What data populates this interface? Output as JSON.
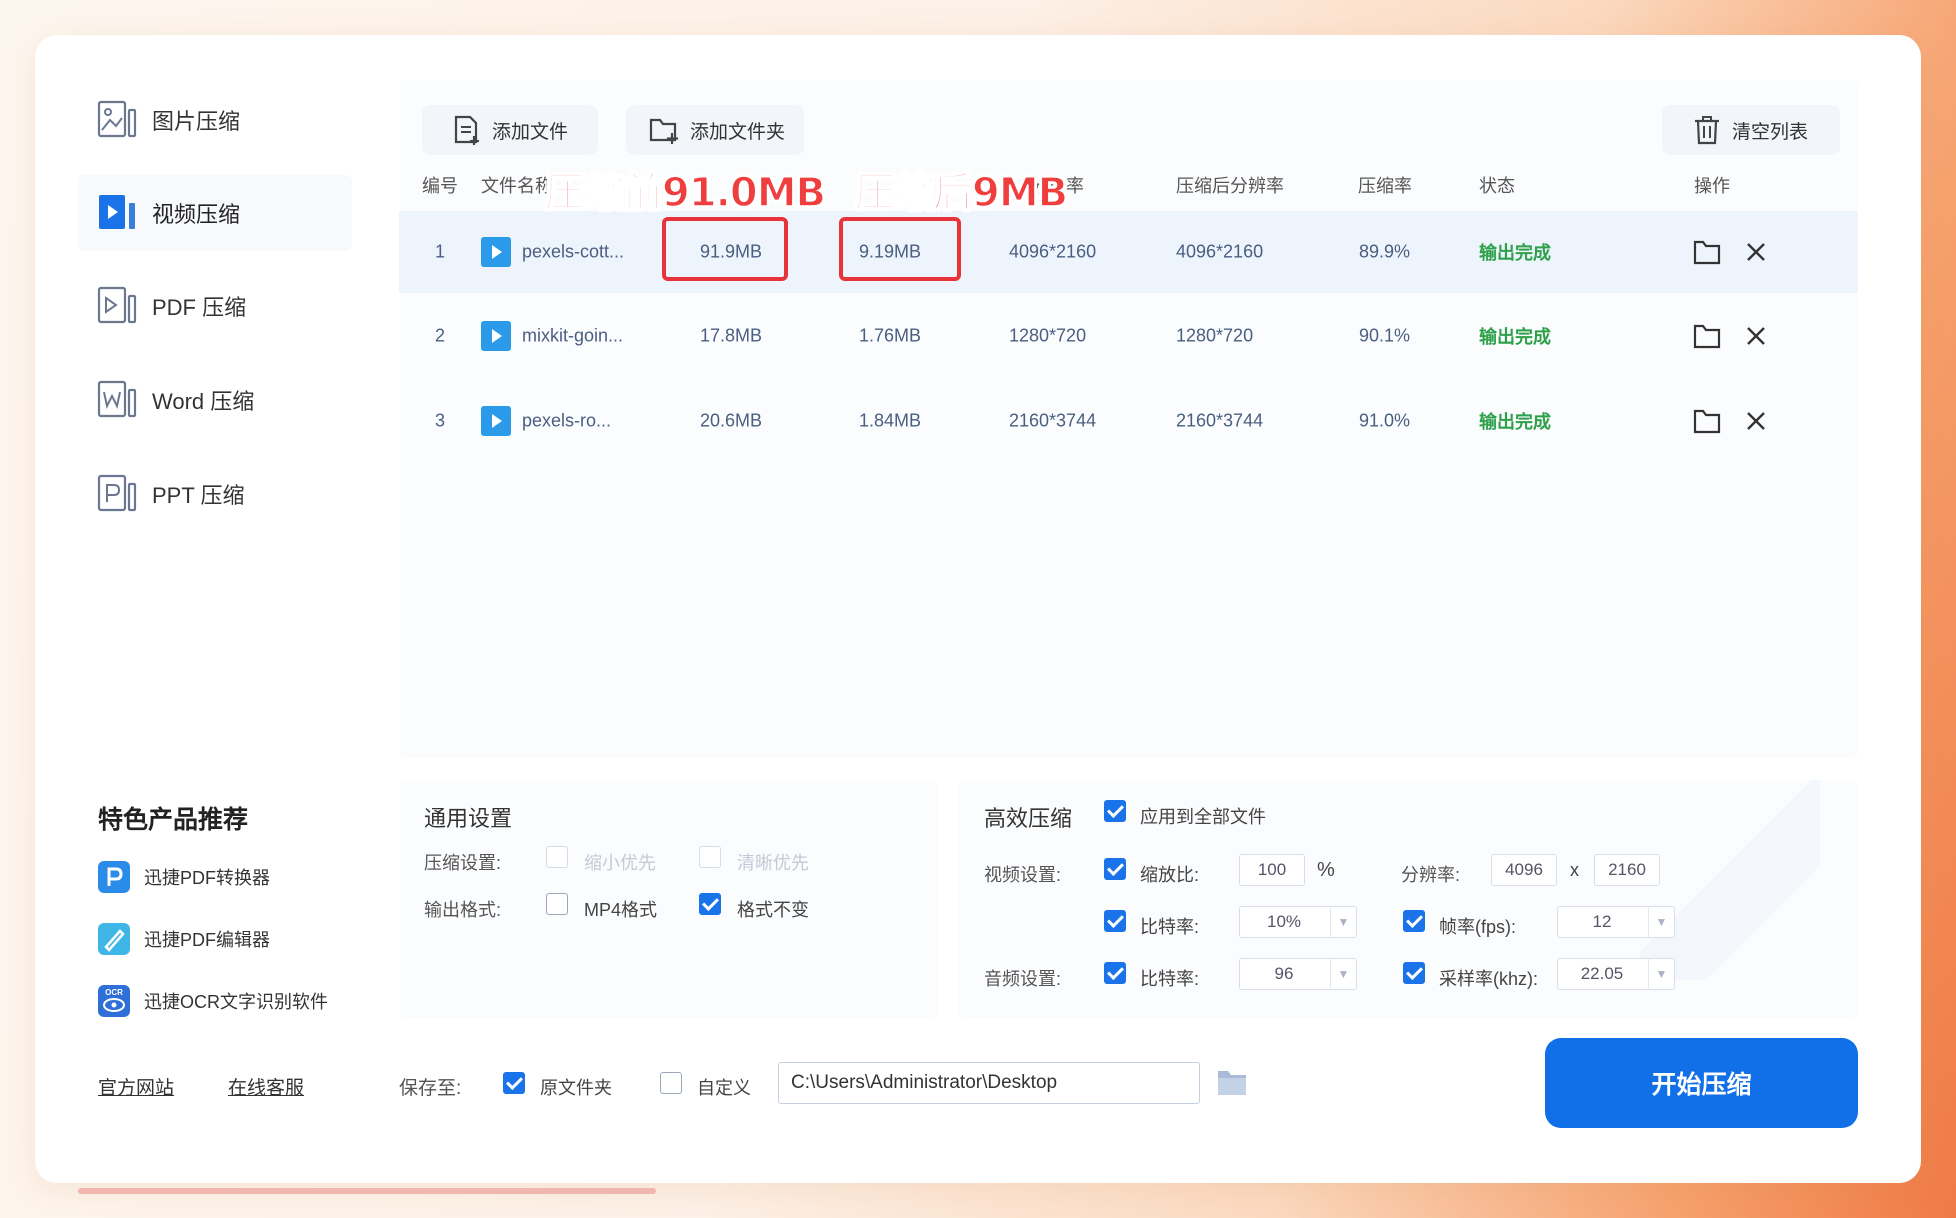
{
  "sidebar": {
    "items": [
      {
        "label": "图片压缩",
        "icon": "image-file-icon"
      },
      {
        "label": "视频压缩",
        "icon": "video-file-icon"
      },
      {
        "label": "PDF 压缩",
        "icon": "pdf-file-icon"
      },
      {
        "label": "Word 压缩",
        "icon": "word-file-icon"
      },
      {
        "label": "PPT 压缩",
        "icon": "ppt-file-icon"
      }
    ],
    "active_index": 1
  },
  "toolbar": {
    "add_file": "添加文件",
    "add_folder": "添加文件夹",
    "clear_list": "清空列表"
  },
  "table": {
    "headers": [
      "编号",
      "文件名称",
      "分辨率",
      "压缩后分辨率",
      "压缩率",
      "状态",
      "操作"
    ],
    "rows": [
      {
        "index": "1",
        "name": "pexels-cott...",
        "size_before": "91.9MB",
        "size_after": "9.19MB",
        "resolution": "4096*2160",
        "res_after": "4096*2160",
        "ratio": "89.9%",
        "status": "输出完成"
      },
      {
        "index": "2",
        "name": "mixkit-goin...",
        "size_before": "17.8MB",
        "size_after": "1.76MB",
        "resolution": "1280*720",
        "res_after": "1280*720",
        "ratio": "90.1%",
        "status": "输出完成"
      },
      {
        "index": "3",
        "name": "pexels-ro...",
        "size_before": "20.6MB",
        "size_after": "1.84MB",
        "resolution": "2160*3744",
        "res_after": "2160*3744",
        "ratio": "91.0%",
        "status": "输出完成"
      }
    ]
  },
  "annotations": {
    "before": "压缩前91.0MB",
    "after": "压缩后9MB"
  },
  "general_settings": {
    "title": "通用设置",
    "compress_label": "压缩设置:",
    "opt_small": "缩小优先",
    "opt_clear": "清晰优先",
    "format_label": "输出格式:",
    "opt_mp4": "MP4格式",
    "opt_keep": "格式不变"
  },
  "efficient": {
    "title": "高效压缩",
    "apply_all": "应用到全部文件",
    "video_label": "视频设置:",
    "scale_label": "缩放比:",
    "scale_value": "100",
    "scale_unit": "%",
    "resolution_label": "分辨率:",
    "res_w": "4096",
    "res_x": "x",
    "res_h": "2160",
    "bitrate_label": "比特率:",
    "bitrate_value": "10%",
    "fps_label": "帧率(fps):",
    "fps_value": "12",
    "audio_label": "音频设置:",
    "audio_bitrate_label": "比特率:",
    "audio_bitrate_value": "96",
    "sample_label": "采样率(khz):",
    "sample_value": "22.05"
  },
  "recommend": {
    "title": "特色产品推荐",
    "items": [
      "迅捷PDF转换器",
      "迅捷PDF编辑器",
      "迅捷OCR文字识别软件"
    ],
    "ocr_badge": "OCR"
  },
  "footer": {
    "website": "官方网站",
    "service": "在线客服",
    "save_to": "保存至:",
    "opt_original": "原文件夹",
    "opt_custom": "自定义",
    "path": "C:\\Users\\Administrator\\Desktop",
    "start": "开始压缩"
  },
  "colors": {
    "accent": "#1170e8",
    "status": "#2ea04a",
    "highlight": "#e8333a"
  }
}
